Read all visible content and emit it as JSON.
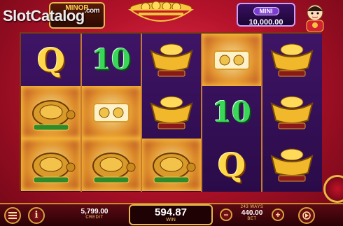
{
  "watermark": {
    "main": "SlotCatalog",
    "suffix": ".com"
  },
  "jackpots": {
    "minor": {
      "label": "MINOR"
    },
    "mini": {
      "label": "MINI",
      "value": "10,000.00"
    }
  },
  "reels": [
    [
      "Q",
      "turtle",
      "turtle"
    ],
    [
      "10",
      "coin-stamp",
      "turtle"
    ],
    [
      "gold-ingot",
      "gold-ingot",
      "turtle"
    ],
    [
      "coin-stamp",
      "10",
      "Q"
    ],
    [
      "gold-ingot",
      "gold-ingot",
      "gold-ingot"
    ]
  ],
  "winning_cells": [
    [
      0,
      1
    ],
    [
      0,
      2
    ],
    [
      1,
      1
    ],
    [
      1,
      2
    ],
    [
      2,
      2
    ],
    [
      3,
      0
    ]
  ],
  "bottom": {
    "credit_value": "5,799.00",
    "credit_label": "CREDIT",
    "win_value": "594.87",
    "win_label": "WIN",
    "ways_label": "243 WAYS",
    "bet_value": "440.00",
    "bet_label": "BET",
    "minus": "−",
    "plus": "+",
    "info": "i"
  },
  "colors": {
    "reel_bg": "#3f1466",
    "frame_gold": "#e8b84a",
    "background_red": "#b3122a"
  }
}
